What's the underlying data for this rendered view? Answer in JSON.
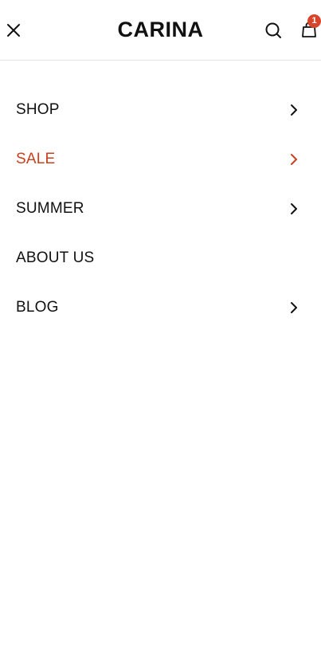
{
  "header": {
    "logo": "CARINA",
    "cart_count": "1"
  },
  "colors": {
    "text": "#111111",
    "accent": "#c8401d",
    "badge": "#d8452a",
    "divider": "#e6e6e6"
  },
  "icons": {
    "close": "close-icon",
    "search": "search-icon",
    "cart": "shopping-bag-icon",
    "chevron": "chevron-right-icon"
  },
  "menu": {
    "items": [
      {
        "label": "SHOP",
        "has_submenu": true,
        "highlight": false
      },
      {
        "label": "SALE",
        "has_submenu": true,
        "highlight": true
      },
      {
        "label": "SUMMER",
        "has_submenu": true,
        "highlight": false
      },
      {
        "label": "ABOUT US",
        "has_submenu": false,
        "highlight": false
      },
      {
        "label": "BLOG",
        "has_submenu": true,
        "highlight": false
      }
    ]
  }
}
